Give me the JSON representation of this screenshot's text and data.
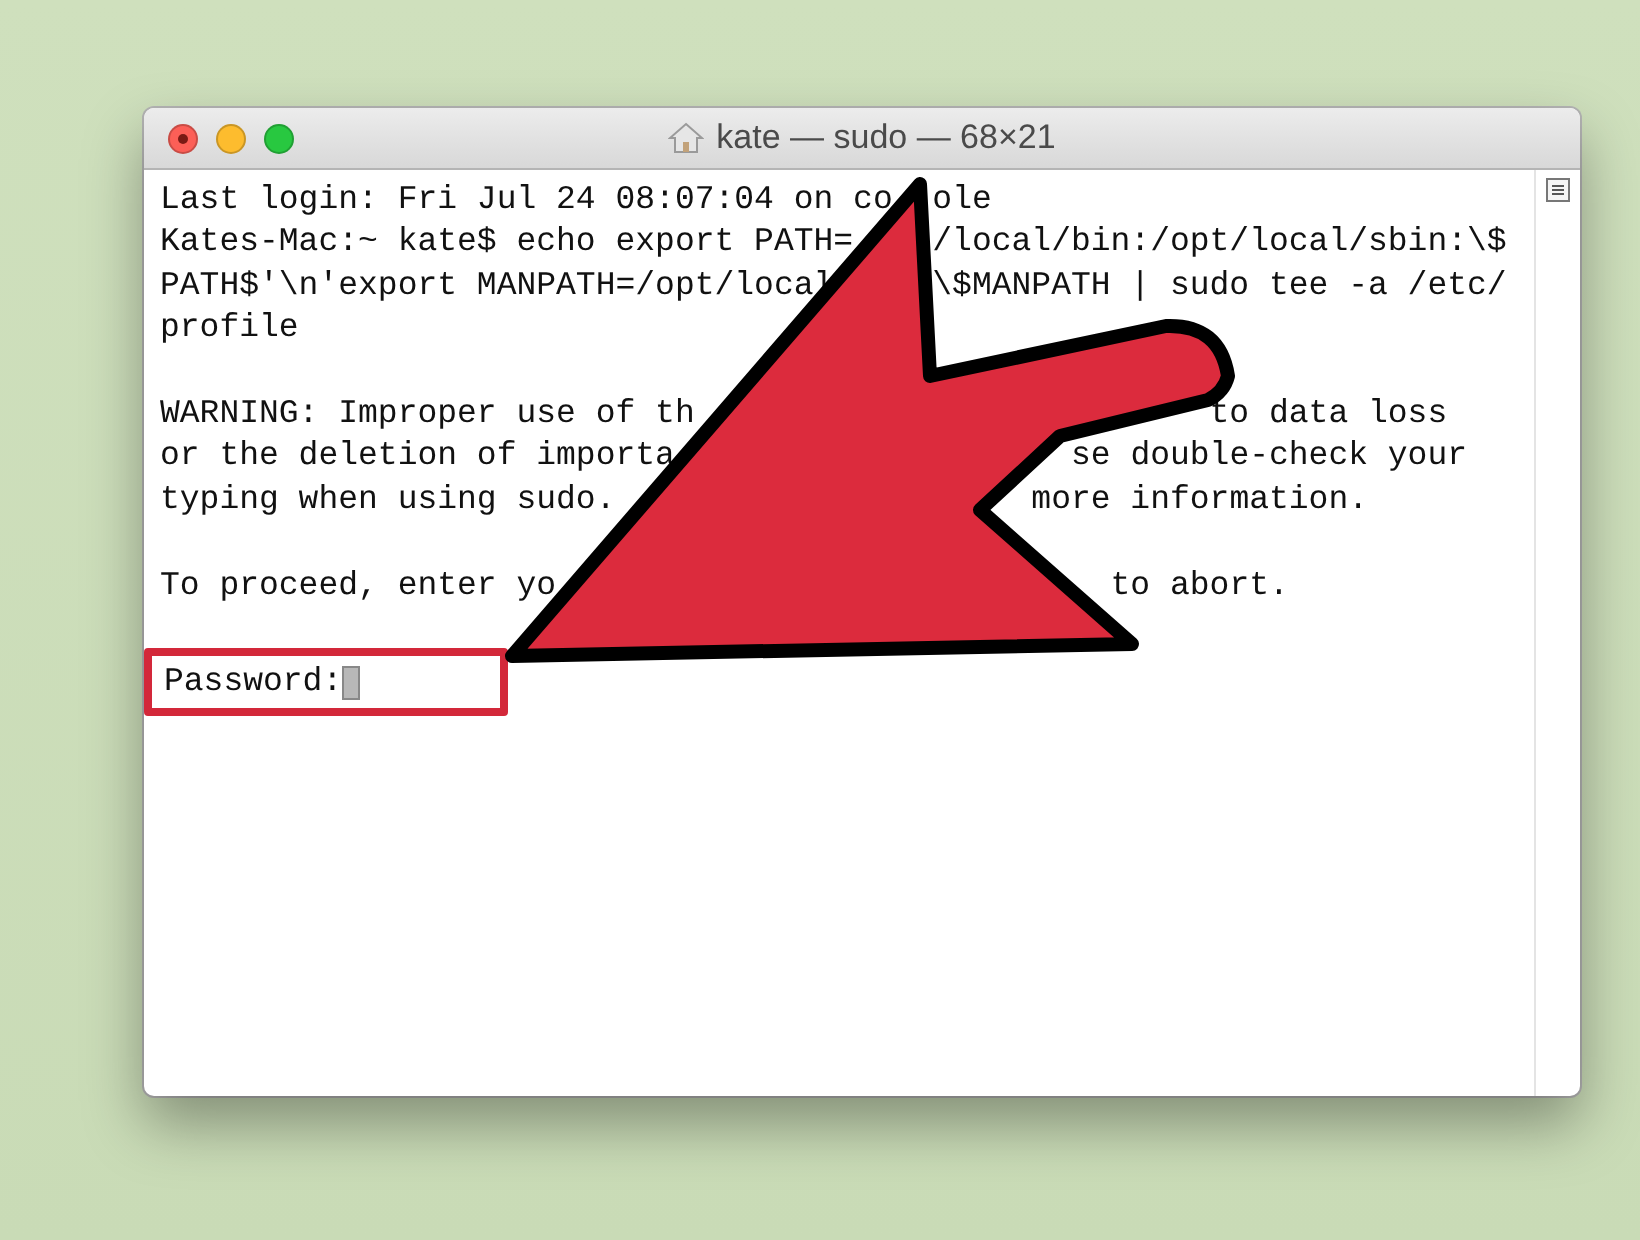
{
  "window": {
    "title": "kate — sudo — 68×21"
  },
  "terminal": {
    "blocks": [
      [
        [
          "Last login: Fri Jul 24 08:07:04 on co",
          "ole"
        ],
        [
          "Kates-Mac:~ kate$ echo export PATH=",
          "/local/bin:/opt/local/sbin:\\$"
        ],
        [
          "PATH$'\\n'export MANPATH=/opt/local",
          "\\$MANPATH | sudo tee -a /etc/"
        ],
        [
          "profile"
        ]
      ],
      [
        [
          "WARNING: Improper use of th",
          "to data loss"
        ],
        [
          "or the deletion of importa",
          "se double-check your"
        ],
        [
          "typing when using sudo. ",
          "more information."
        ]
      ],
      [
        [
          "To proceed, enter yo",
          "to abort."
        ]
      ]
    ],
    "prompt": {
      "label": "Password:",
      "highlighted": true
    }
  }
}
